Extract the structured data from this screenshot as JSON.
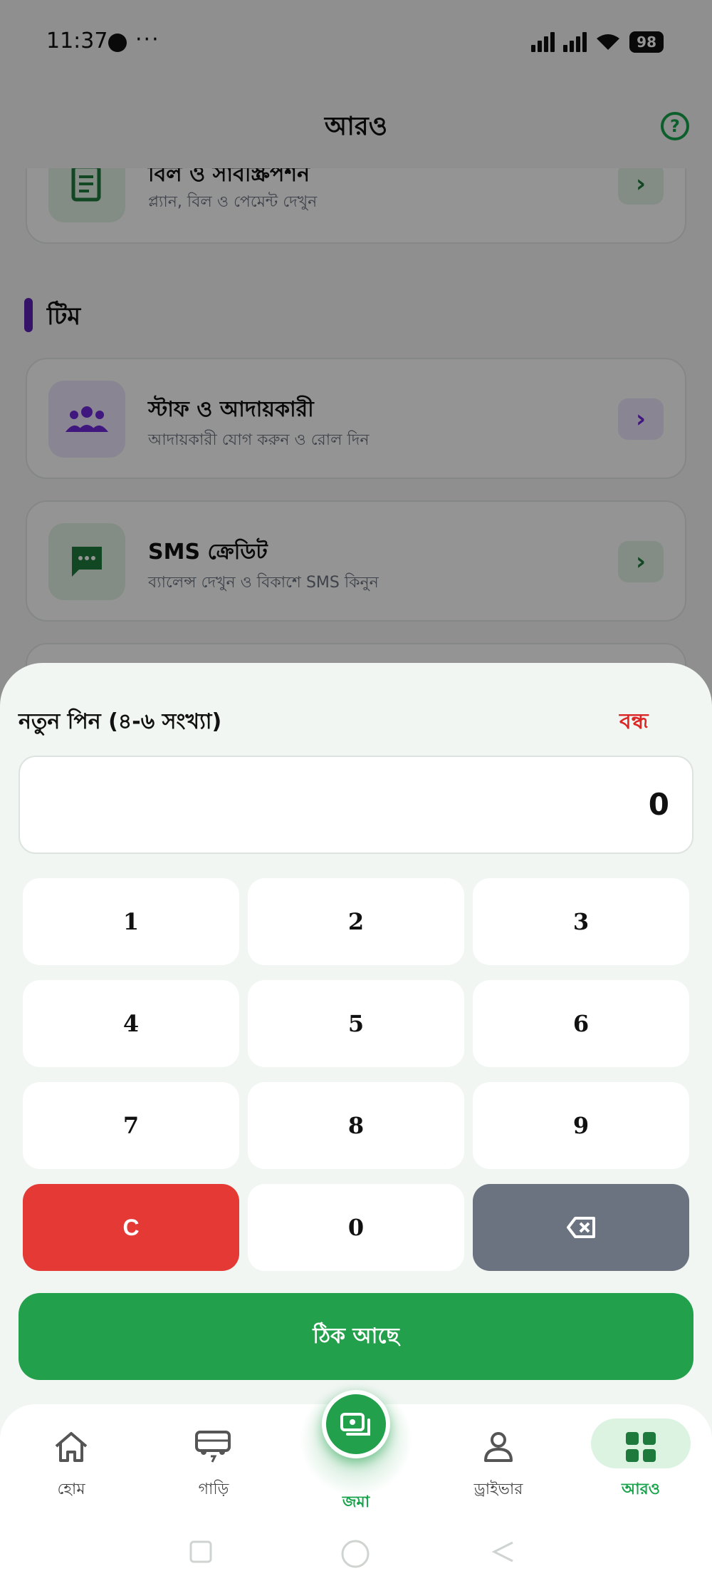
{
  "status_bar": {
    "time": "11:37",
    "dots": "···",
    "battery": "98"
  },
  "app_bar": {
    "title": "আরও"
  },
  "background": {
    "card_billing": {
      "title": "বিল ও সাবস্ক্রিপশন",
      "subtitle": "প্ল্যান, বিল ও পেমেন্ট দেখুন"
    },
    "section_team": {
      "title": "টিম"
    },
    "card_staff": {
      "title": "স্টাফ ও আদায়কারী",
      "subtitle": "আদায়কারী যোগ করুন ও রোল দিন"
    },
    "card_sms": {
      "title": "SMS ক্রেডিট",
      "subtitle": "ব্যালেন্স দেখুন ও বিকাশে SMS কিনুন"
    }
  },
  "pin_sheet": {
    "title": "নতুন পিন (৪-৬ সংখ্যা)",
    "close_label": "বন্ধ",
    "pin_value": "0",
    "keys": [
      "1",
      "2",
      "3",
      "4",
      "5",
      "6",
      "7",
      "8",
      "9"
    ],
    "clear_label": "C",
    "zero_label": "0",
    "ok_label": "ঠিক আছে"
  },
  "bottom_nav": {
    "items": [
      {
        "label": "হোম",
        "icon": "home-icon"
      },
      {
        "label": "গাড়ি",
        "icon": "bus-icon"
      },
      {
        "label": "জমা",
        "icon": "cash-icon"
      },
      {
        "label": "ড্রাইভার",
        "icon": "person-icon"
      },
      {
        "label": "আরও",
        "icon": "grid-icon"
      }
    ],
    "active_index": 4
  },
  "colors": {
    "primary_green": "#22a04b",
    "danger_red": "#e53935",
    "backspace_gray": "#6b7280",
    "section_accent": "#5b21b6"
  }
}
